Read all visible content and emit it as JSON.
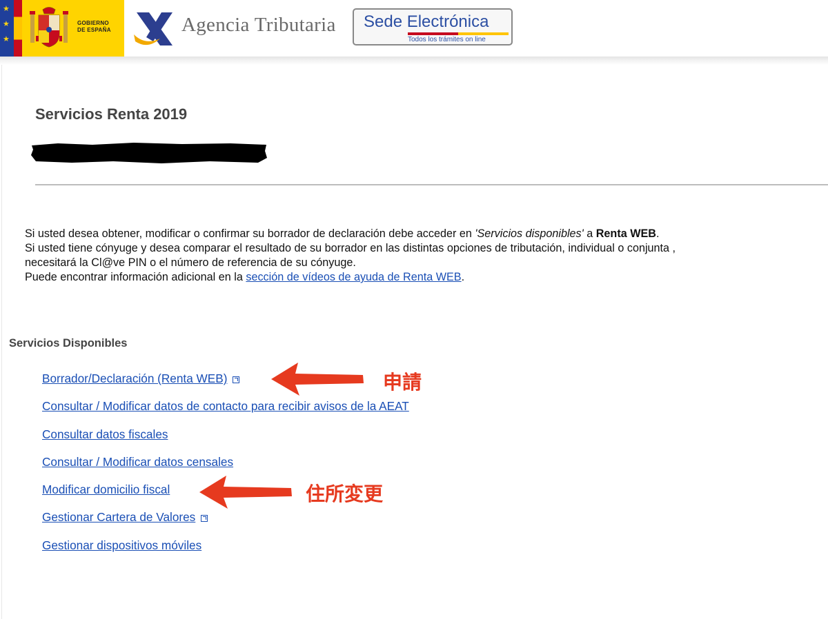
{
  "header": {
    "gov_line1": "GOBIERNO",
    "gov_line2": "DE ESPAÑA",
    "agency_name": "Agencia Tributaria",
    "sede_title": "Sede Electrónica",
    "sede_subtitle": "Todos los trámites on line"
  },
  "page": {
    "title": "Servicios Renta 2019"
  },
  "intro": {
    "line1_a": "Si usted desea obtener, modificar o confirmar su borrador de declaración debe acceder en ",
    "line1_italic": "'Servicios disponibles'",
    "line1_b": " a ",
    "line1_bold": "Renta WEB",
    "line1_end": ".",
    "line2": "Si usted tiene cónyuge y desea comparar el resultado de su borrador en las distintas opciones de tributación, individual o conjunta ,",
    "line3": "necesitará la Cl@ve PIN o el número de referencia de su cónyuge.",
    "line4_a": "Puede encontrar información adicional en la ",
    "line4_link": "sección de vídeos de ayuda de Renta WEB",
    "line4_end": "."
  },
  "services": {
    "title": "Servicios Disponibles",
    "items": [
      {
        "label": "Borrador/Declaración (Renta WEB)",
        "external": true
      },
      {
        "label": "Consultar / Modificar datos de contacto para recibir avisos de la AEAT",
        "external": false
      },
      {
        "label": "Consultar datos fiscales",
        "external": false
      },
      {
        "label": "Consultar / Modificar datos censales",
        "external": false
      },
      {
        "label": "Modificar domicilio fiscal",
        "external": false
      },
      {
        "label": "Gestionar Cartera de Valores",
        "external": true
      },
      {
        "label": "Gestionar dispositivos móviles",
        "external": false
      }
    ]
  },
  "annotations": {
    "apply": "申請",
    "address_change": "住所変更",
    "color": "#e63a1f"
  },
  "colors": {
    "link": "#1a4fb5",
    "gov_yellow": "#ffd400",
    "eu_blue": "#1f3f9b"
  }
}
